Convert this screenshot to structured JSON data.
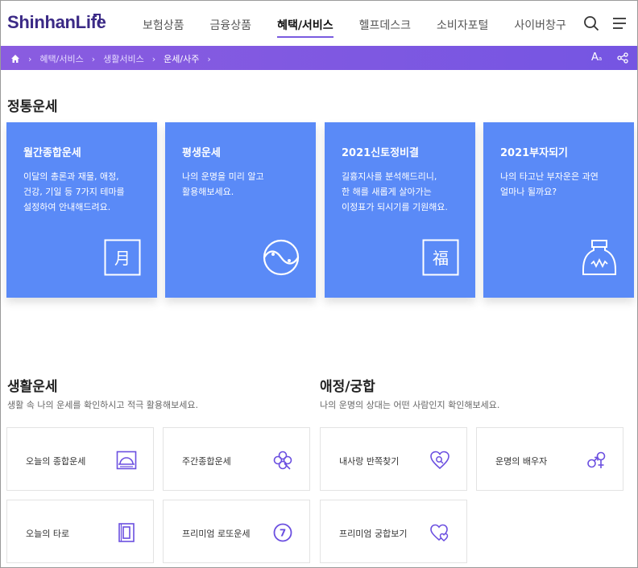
{
  "brand": {
    "logo_text": "ShinhanLife"
  },
  "nav": {
    "items": [
      {
        "label": "보험상품"
      },
      {
        "label": "금융상품"
      },
      {
        "label": "혜택/서비스"
      },
      {
        "label": "헬프데스크"
      },
      {
        "label": "소비자포털"
      },
      {
        "label": "사이버창구"
      }
    ],
    "active_index": 2
  },
  "breadcrumb": {
    "items": [
      "혜택/서비스",
      "생활서비스",
      "운세/사주"
    ],
    "font_size_label": "A",
    "font_size_sub": "a"
  },
  "traditional": {
    "title": "정통운세",
    "cards": [
      {
        "title": "월간종합운세",
        "desc": "이달의 총론과 재물, 애정,\n건강, 기일 등 7가지 테마를\n설정하여 안내해드려요.",
        "icon": "moon-character-icon",
        "icon_char": "月"
      },
      {
        "title": "평생운세",
        "desc": "나의 운명을 미리 알고\n활용해보세요.",
        "icon": "yin-yang-icon"
      },
      {
        "title": "2021신토정비결",
        "desc": "길흉지사를 분석해드리니,\n한 해를 새롭게 살아가는\n이정표가 되시기를 기원해요.",
        "icon": "fortune-character-icon",
        "icon_char": "福"
      },
      {
        "title": "2021부자되기",
        "desc": "나의 타고난 부자운은 과연\n얼마나 될까요?",
        "icon": "money-bag-icon"
      }
    ]
  },
  "life": {
    "title": "생활운세",
    "subtitle": "생활 속 나의 운세를 확인하시고 적극 활용해보세요.",
    "tiles": [
      {
        "label": "오늘의 종합운세",
        "icon": "sunrise-icon"
      },
      {
        "label": "주간종합운세",
        "icon": "clover-icon"
      },
      {
        "label": "오늘의 타로",
        "icon": "tarot-card-icon"
      },
      {
        "label": "프리미엄 로또운세",
        "icon": "lotto-ball-icon",
        "icon_text": "7"
      }
    ]
  },
  "love": {
    "title": "애정/궁합",
    "subtitle": "나의 운명의 상대는 어떤 사람인지 확인해보세요.",
    "tiles": [
      {
        "label": "내사랑 반쪽찾기",
        "icon": "heart-search-icon"
      },
      {
        "label": "운명의 배우자",
        "icon": "gender-symbols-icon"
      },
      {
        "label": "프리미엄 궁합보기",
        "icon": "double-heart-icon"
      }
    ]
  },
  "colors": {
    "brand": "#3b2a86",
    "accent": "#7a5be0",
    "card_blue": "#5a8af7",
    "crumb_bar": "#7a58e1"
  }
}
